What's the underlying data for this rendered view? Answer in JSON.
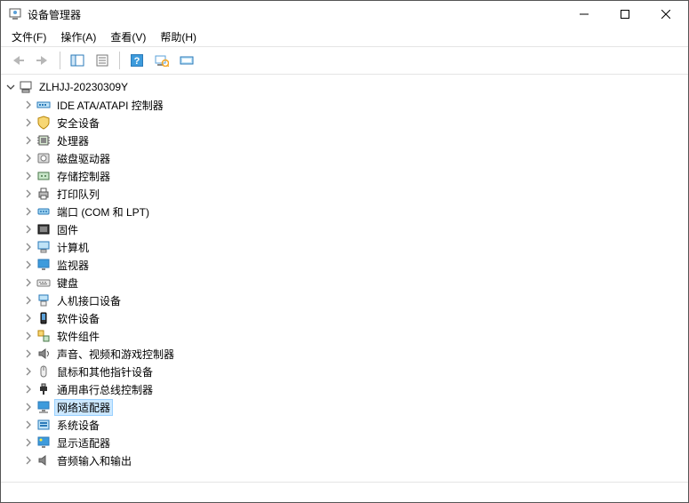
{
  "window": {
    "title": "设备管理器"
  },
  "menu": {
    "file": "文件(F)",
    "action": "操作(A)",
    "view": "查看(V)",
    "help": "帮助(H)"
  },
  "tree": {
    "root": {
      "label": "ZLHJJ-20230309Y",
      "expanded": true
    },
    "children": [
      {
        "label": "IDE ATA/ATAPI 控制器",
        "icon": "ide"
      },
      {
        "label": "安全设备",
        "icon": "security"
      },
      {
        "label": "处理器",
        "icon": "cpu"
      },
      {
        "label": "磁盘驱动器",
        "icon": "disk"
      },
      {
        "label": "存储控制器",
        "icon": "storage"
      },
      {
        "label": "打印队列",
        "icon": "printer"
      },
      {
        "label": "端口 (COM 和 LPT)",
        "icon": "port"
      },
      {
        "label": "固件",
        "icon": "firmware"
      },
      {
        "label": "计算机",
        "icon": "computer"
      },
      {
        "label": "监视器",
        "icon": "monitor"
      },
      {
        "label": "键盘",
        "icon": "keyboard"
      },
      {
        "label": "人机接口设备",
        "icon": "hid"
      },
      {
        "label": "软件设备",
        "icon": "software"
      },
      {
        "label": "软件组件",
        "icon": "component"
      },
      {
        "label": "声音、视频和游戏控制器",
        "icon": "sound"
      },
      {
        "label": "鼠标和其他指针设备",
        "icon": "mouse"
      },
      {
        "label": "通用串行总线控制器",
        "icon": "usb"
      },
      {
        "label": "网络适配器",
        "icon": "network",
        "selected": true
      },
      {
        "label": "系统设备",
        "icon": "system"
      },
      {
        "label": "显示适配器",
        "icon": "display"
      },
      {
        "label": "音频输入和输出",
        "icon": "audio"
      }
    ]
  }
}
